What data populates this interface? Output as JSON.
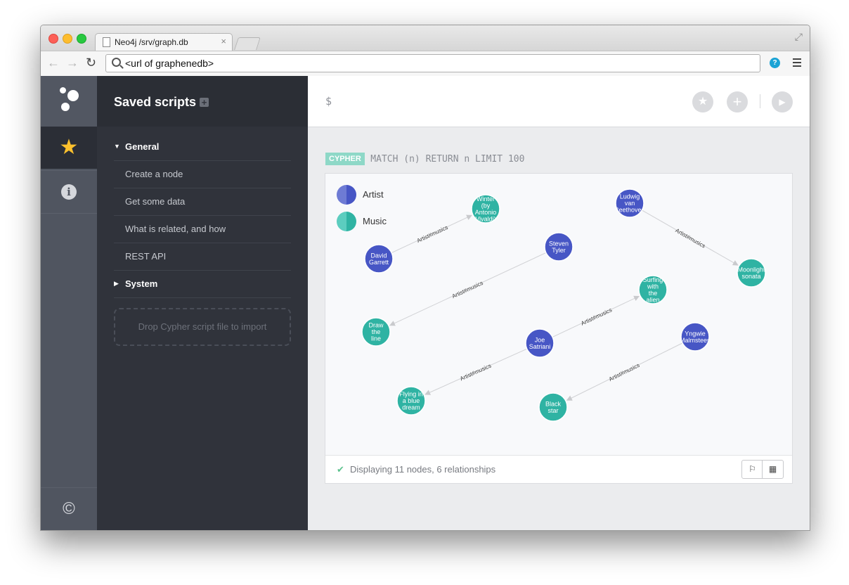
{
  "browser": {
    "tab_title": "Neo4j /srv/graph.db",
    "tab_close": "×",
    "url": "<url of graphenedb>",
    "back": "←",
    "forward": "→",
    "reload": "↻",
    "fullscreen": "⤢",
    "extension": "?"
  },
  "rail": {
    "copyright": "©",
    "star": "★",
    "info": "i"
  },
  "drawer": {
    "title": "Saved scripts",
    "add": "+",
    "folders": [
      {
        "label": "General",
        "caret": "▼"
      },
      {
        "label": "System",
        "caret": "▶"
      }
    ],
    "scripts": [
      "Create a node",
      "Get some data",
      "What is related, and how",
      "REST API"
    ],
    "dropzone": "Drop Cypher script file to import"
  },
  "editor": {
    "prompt": "$",
    "favorite": "★",
    "add": "+",
    "run": "▶"
  },
  "frame": {
    "badge": "CYPHER",
    "query": "MATCH (n) RETURN n LIMIT 100",
    "status_check": "✔",
    "status": "Displaying 11 nodes, 6 relationships",
    "graph_view_icon": "⚐",
    "table_view_icon": "▦"
  },
  "legend": [
    {
      "label": "Artist",
      "color": "#4756c5",
      "half": "#6e7bd4"
    },
    {
      "label": "Music",
      "color": "#2fb3a3",
      "half": "#5ccdbf"
    }
  ],
  "graph": {
    "relationship_label": "Artist#musics",
    "nodes": [
      {
        "id": "david",
        "label": "David Garrett",
        "type": "Artist"
      },
      {
        "id": "winter",
        "label": "Winter (by Antonio Vivaldi)",
        "type": "Music"
      },
      {
        "id": "steven",
        "label": "Steven Tyler",
        "type": "Artist"
      },
      {
        "id": "draw",
        "label": "Draw the line",
        "type": "Music"
      },
      {
        "id": "ludwig",
        "label": "Ludwig van Beethoven",
        "type": "Artist"
      },
      {
        "id": "moon",
        "label": "Moonlight sonata",
        "type": "Music"
      },
      {
        "id": "joe",
        "label": "Joe Satriani",
        "type": "Artist"
      },
      {
        "id": "surfing",
        "label": "Surfing with the alien",
        "type": "Music"
      },
      {
        "id": "flying",
        "label": "Flying in a blue dream",
        "type": "Music"
      },
      {
        "id": "yngwie",
        "label": "Yngwie Malmsteen",
        "type": "Artist"
      },
      {
        "id": "black",
        "label": "Black star",
        "type": "Music"
      }
    ],
    "edges": [
      {
        "from": "david",
        "to": "winter"
      },
      {
        "from": "steven",
        "to": "draw"
      },
      {
        "from": "ludwig",
        "to": "moon"
      },
      {
        "from": "joe",
        "to": "surfing"
      },
      {
        "from": "joe",
        "to": "flying"
      },
      {
        "from": "yngwie",
        "to": "black"
      }
    ]
  }
}
